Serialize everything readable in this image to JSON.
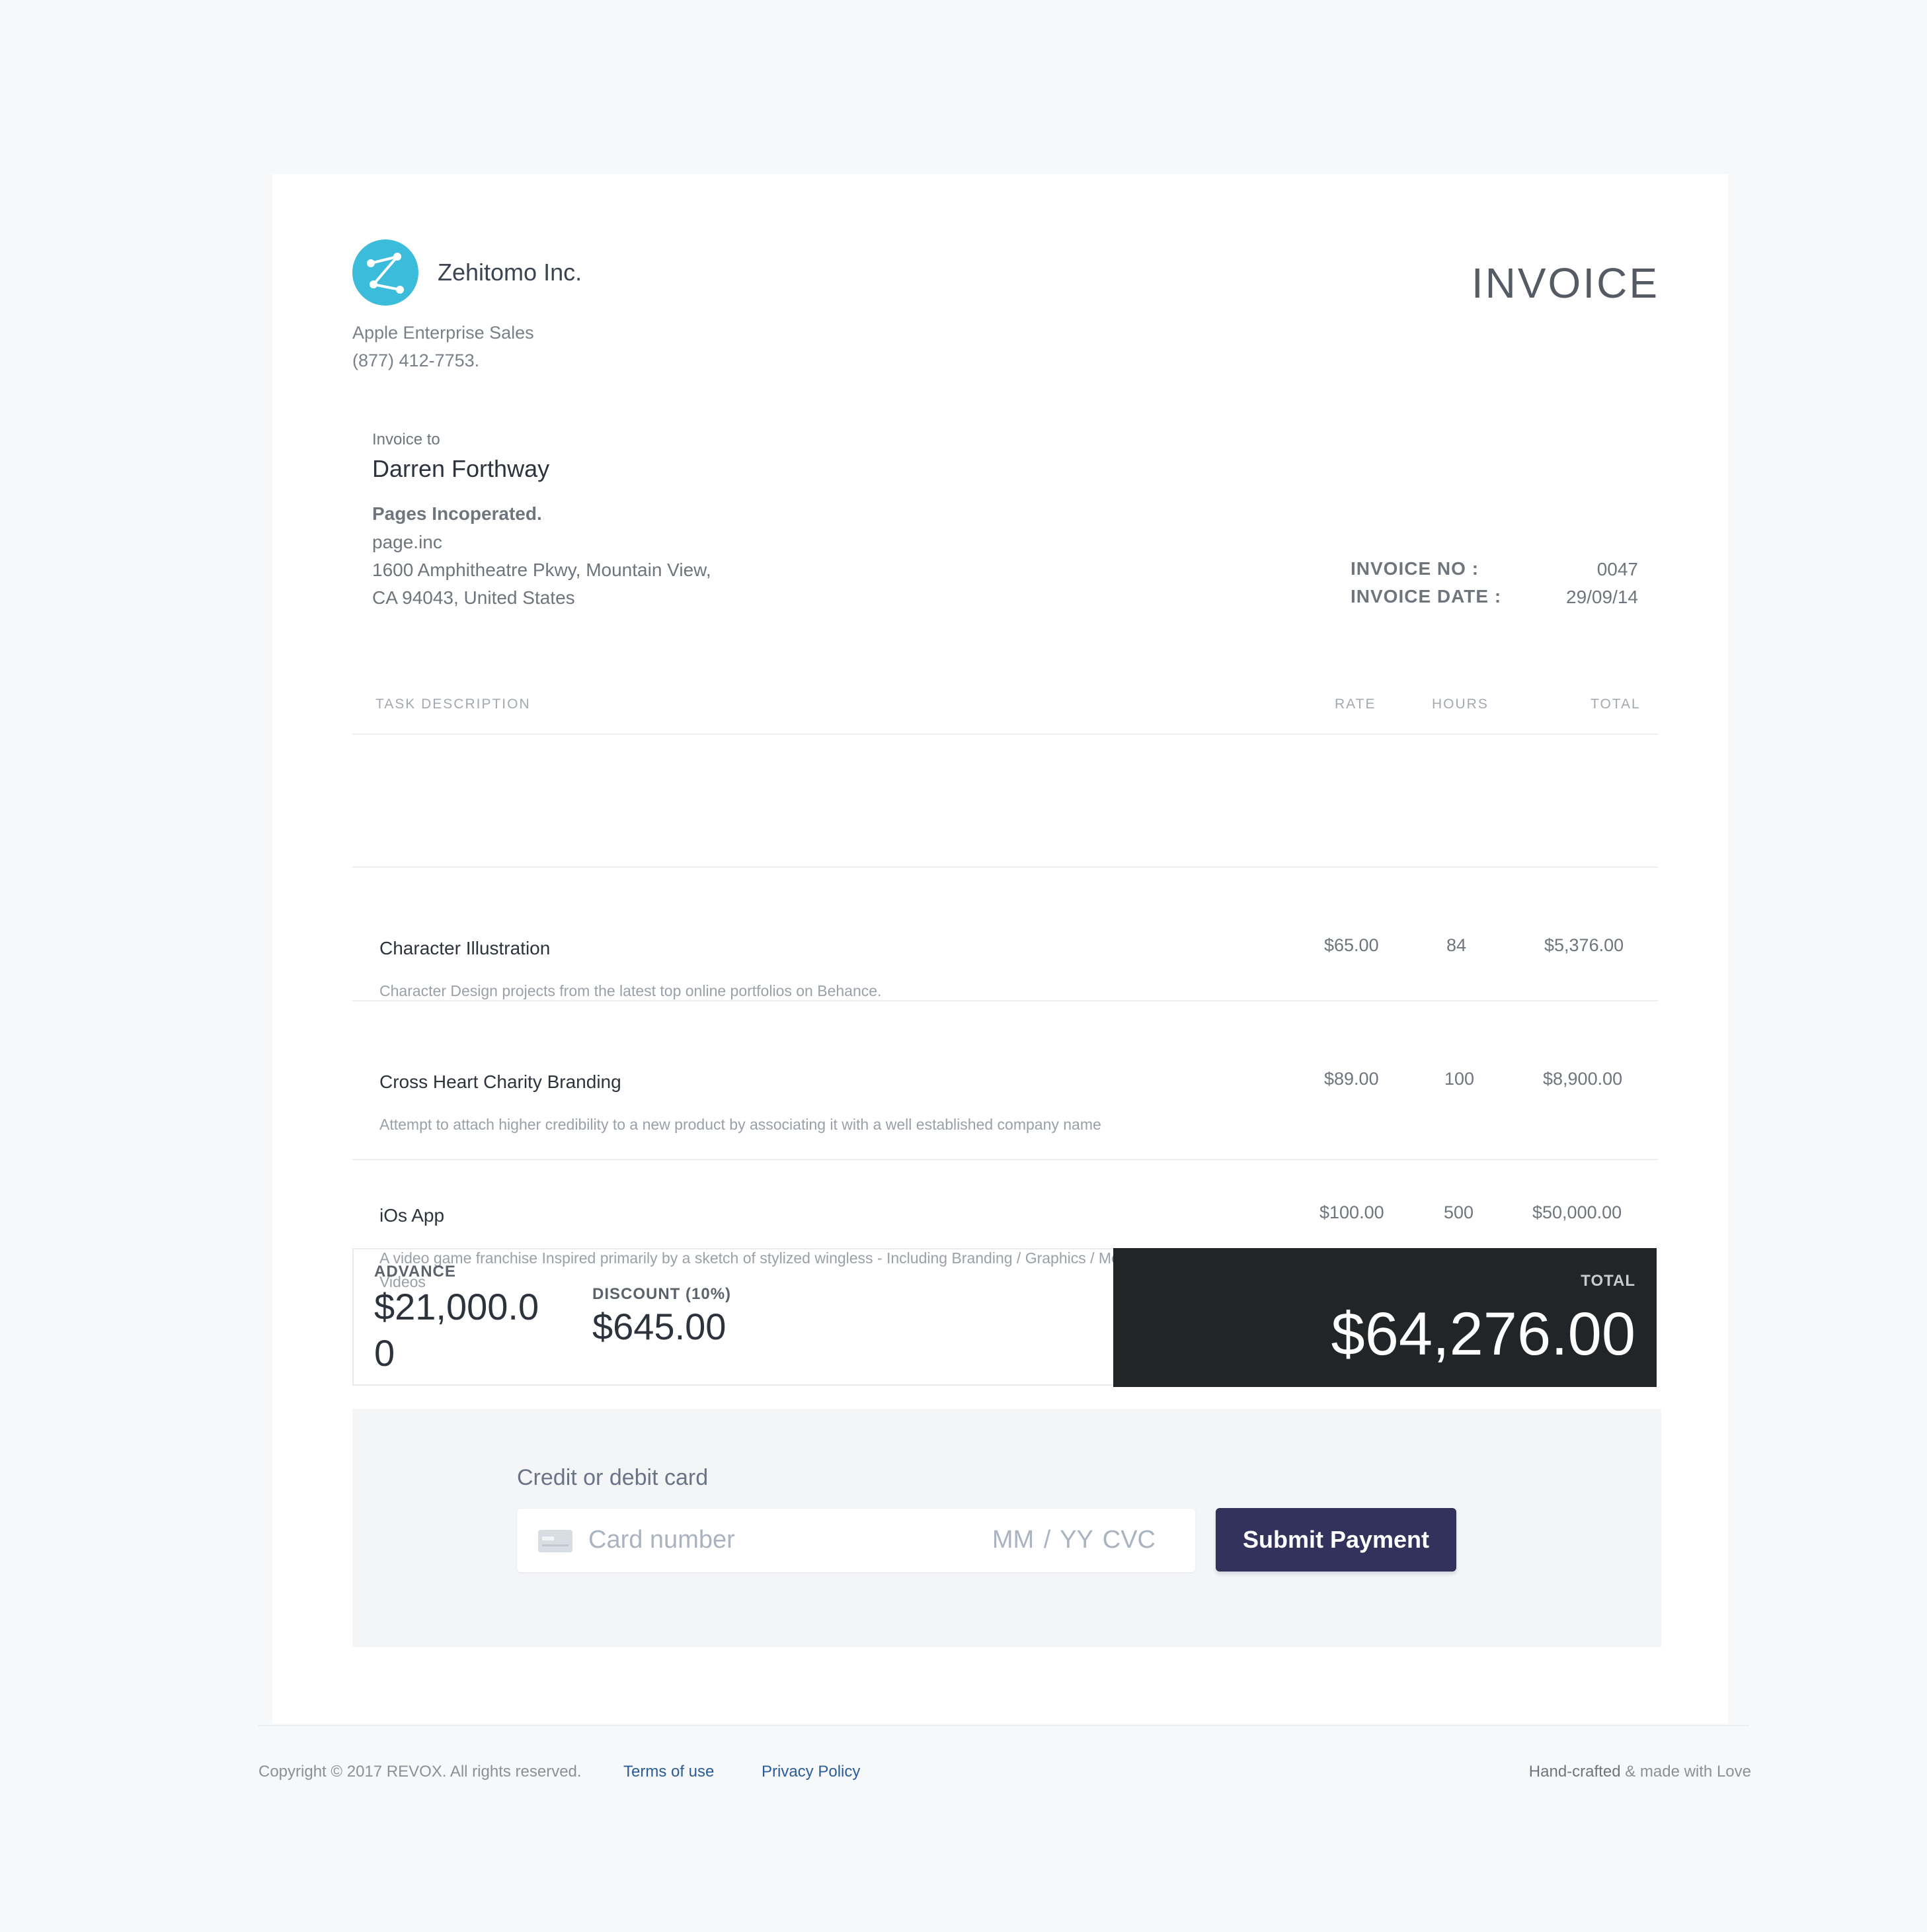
{
  "brand": {
    "name": "Zehitomo Inc.",
    "logo_color": "#3cbcdb",
    "lines": [
      "Apple Enterprise Sales",
      "(877) 412-7753."
    ]
  },
  "document_title": "INVOICE",
  "invoice_to": {
    "label": "Invoice to",
    "name": "Darren Forthway",
    "company": "Pages Incoperated.",
    "lines": [
      "page.inc",
      "1600 Amphitheatre Pkwy, Mountain View,",
      "CA 94043, United States"
    ]
  },
  "meta": {
    "number_label": "INVOICE NO :",
    "number_value": "0047",
    "date_label": "INVOICE DATE :",
    "date_value": "29/09/14"
  },
  "table": {
    "headers": {
      "task": "TASK DESCRIPTION",
      "rate": "RATE",
      "hours": "HOURS",
      "total": "TOTAL"
    },
    "rows": [
      {
        "title": "Character Illustration",
        "description": "Character Design projects from the latest top online portfolios on Behance.",
        "rate": "$65.00",
        "hours": "84",
        "total": "$5,376.00"
      },
      {
        "title": "Cross Heart Charity Branding",
        "description": "Attempt to attach higher credibility to a new product by associating it with a well established company name",
        "rate": "$89.00",
        "hours": "100",
        "total": "$8,900.00"
      },
      {
        "title": "iOs App",
        "description": "A video game franchise Inspired primarily by a sketch of stylized wingless - Including Branding / Graphics / Motion Picture & Videos",
        "rate": "$100.00",
        "hours": "500",
        "total": "$50,000.00"
      }
    ]
  },
  "summary": {
    "advance_label": "ADVANCE",
    "advance_value": "$21,000.00",
    "discount_label": "DISCOUNT (10%)",
    "discount_value": "$645.00",
    "total_label": "TOTAL",
    "total_value": "$64,276.00",
    "total_bg": "#222527"
  },
  "payment": {
    "label": "Credit or debit card",
    "card_icon": "credit-card-icon",
    "card_placeholder": "Card number",
    "expiry_cvc_placeholder": "MM / YY  CVC",
    "submit_label": "Submit Payment",
    "submit_color": "#32325d"
  },
  "footer": {
    "copyright": "Copyright © 2017 REVOX. All rights reserved.",
    "terms": "Terms of use",
    "privacy": "Privacy Policy",
    "handcrafted": "Hand-crafted",
    "made_with": "& made with Love"
  }
}
